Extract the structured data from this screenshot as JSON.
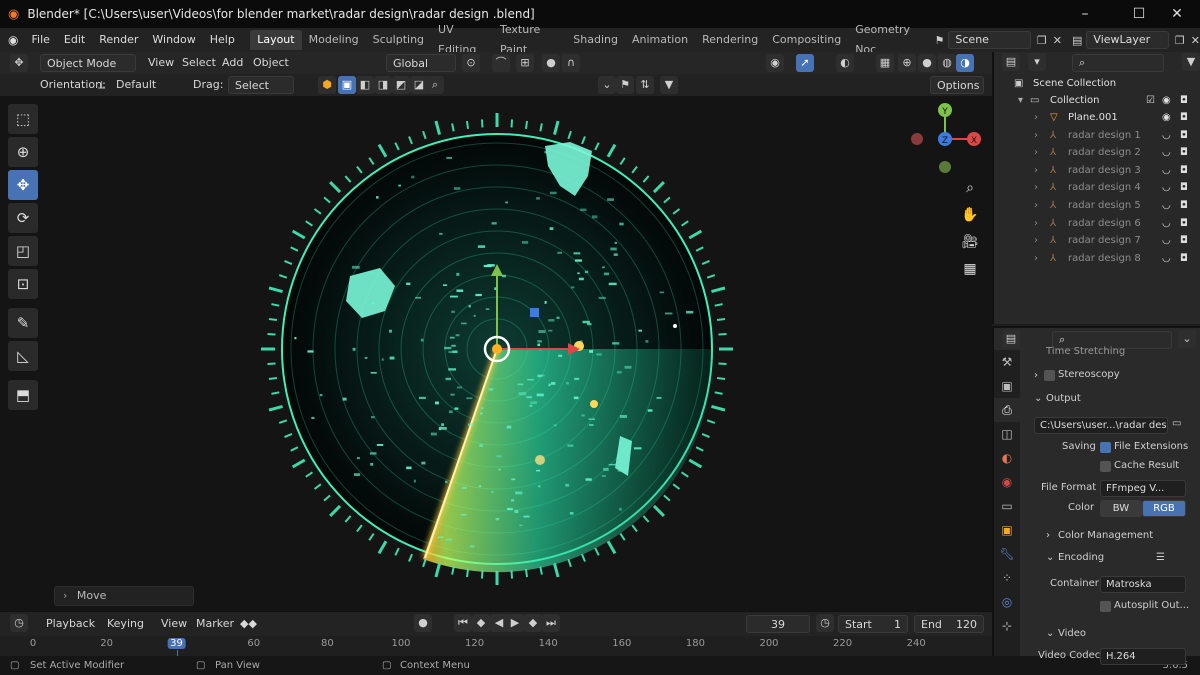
{
  "window": {
    "title": "Blender* [C:\\Users\\user\\Videos\\for blender market\\radar design\\radar design .blend]",
    "controls": [
      "–",
      "☐",
      "✕"
    ]
  },
  "menu": {
    "items": [
      "File",
      "Edit",
      "Render",
      "Window",
      "Help"
    ],
    "workspaces": [
      "Layout",
      "Modeling",
      "Sculpting",
      "UV Editing",
      "Texture Paint",
      "Shading",
      "Animation",
      "Rendering",
      "Compositing",
      "Geometry Noc"
    ],
    "active_workspace": "Layout",
    "scene": "Scene",
    "view_layer": "ViewLayer"
  },
  "header": {
    "mode": "Object Mode",
    "menus": [
      "View",
      "Select",
      "Add",
      "Object"
    ],
    "transform_orientation": "Global",
    "orientation_label": "Orientation:",
    "orientation_value": "Default",
    "drag_label": "Drag:",
    "drag_value": "Select Box",
    "options_label": "Options"
  },
  "viewport": {
    "move_panel": "Move",
    "gizmo_axes": [
      "Y",
      "Z",
      "X"
    ]
  },
  "timeline": {
    "menus": [
      "Playback",
      "Keying",
      "View",
      "Marker"
    ],
    "current_frame": "39",
    "start_label": "Start",
    "start": "1",
    "end_label": "End",
    "end": "120",
    "ticks": [
      "0",
      "20",
      "39",
      "60",
      "80",
      "100",
      "120",
      "140",
      "160",
      "180",
      "200",
      "220",
      "240"
    ],
    "playhead": 39
  },
  "statusbar": {
    "left": "Set Active Modifier",
    "middle": "Pan View",
    "right": "Context Menu",
    "version": "3.6.5"
  },
  "outliner": {
    "scene_collection": "Scene Collection",
    "collection": "Collection",
    "items": [
      "Plane.001",
      "radar design 1",
      "radar design 2",
      "radar design 3",
      "radar design 4",
      "radar design 5",
      "radar design 6",
      "radar design 7",
      "radar design 8"
    ]
  },
  "properties": {
    "time_stretching": "Time Stretching",
    "stereoscopy": "Stereoscopy",
    "output_panel": "Output",
    "output_path": "C:\\Users\\user...\\radar design\\",
    "saving_label": "Saving",
    "file_extensions": "File Extensions",
    "cache_result": "Cache Result",
    "file_format_label": "File Format",
    "file_format": "FFmpeg V...",
    "color_label": "Color",
    "color_options": [
      "BW",
      "RGB"
    ],
    "color_active": "RGB",
    "color_management": "Color Management",
    "encoding": "Encoding",
    "container_label": "Container",
    "container": "Matroska",
    "autosplit": "Autosplit Out...",
    "video": "Video",
    "video_codec_label": "Video Codec",
    "video_codec": "H.264"
  },
  "colors": {
    "accent": "#4772b3",
    "radar_green": "#2fe3a8",
    "sweep_orange": "#ffb020"
  }
}
